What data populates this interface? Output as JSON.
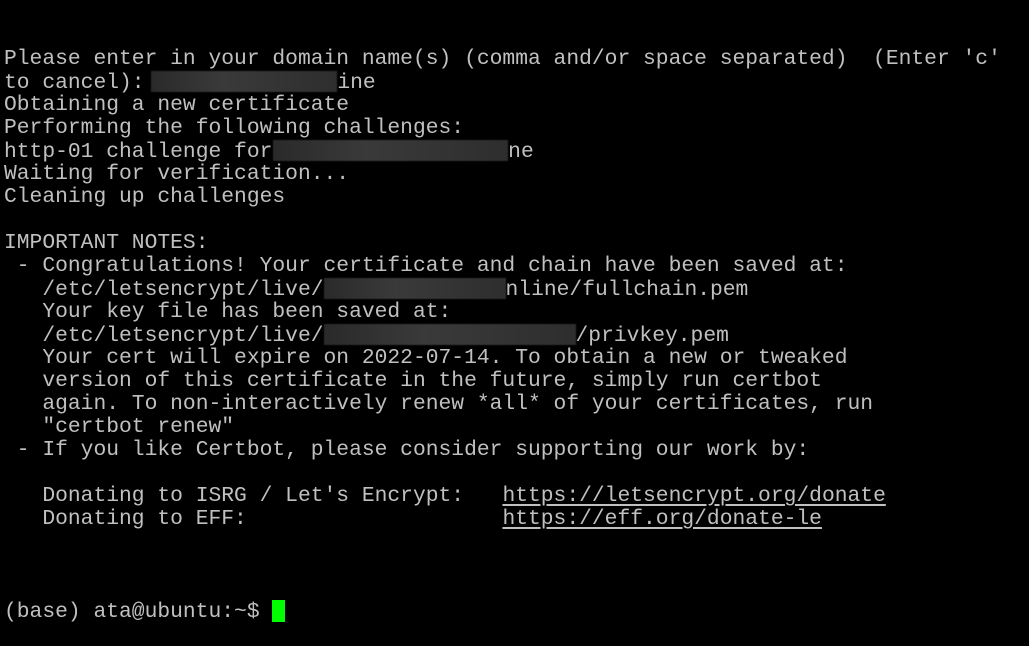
{
  "terminal": {
    "lines": [
      [
        {
          "t": "Please enter in your domain name(s) (comma and/or space separated)  (Enter 'c'"
        }
      ],
      [
        {
          "t": "to cancel): "
        },
        {
          "r": "r1"
        },
        {
          "t": "ine"
        }
      ],
      [
        {
          "t": "Obtaining a new certificate"
        }
      ],
      [
        {
          "t": "Performing the following challenges:"
        }
      ],
      [
        {
          "t": "http-01 challenge for "
        },
        {
          "r": "r2"
        },
        {
          "t": "ne"
        }
      ],
      [
        {
          "t": "Waiting for verification..."
        }
      ],
      [
        {
          "t": "Cleaning up challenges"
        }
      ],
      [
        {
          "t": ""
        }
      ],
      [
        {
          "t": "IMPORTANT NOTES:"
        }
      ],
      [
        {
          "t": " - Congratulations! Your certificate and chain have been saved at:"
        }
      ],
      [
        {
          "t": "   /etc/letsencrypt/live/"
        },
        {
          "r": "r3"
        },
        {
          "t": "nline/fullchain.pem"
        }
      ],
      [
        {
          "t": "   Your key file has been saved at:"
        }
      ],
      [
        {
          "t": "   /etc/letsencrypt/live/"
        },
        {
          "r": "r4"
        },
        {
          "t": "/privkey.pem"
        }
      ],
      [
        {
          "t": "   Your cert will expire on 2022-07-14. To obtain a new or tweaked"
        }
      ],
      [
        {
          "t": "   version of this certificate in the future, simply run certbot"
        }
      ],
      [
        {
          "t": "   again. To non-interactively renew *all* of your certificates, run"
        }
      ],
      [
        {
          "t": "   \"certbot renew\""
        }
      ],
      [
        {
          "t": " - If you like Certbot, please consider supporting our work by:"
        }
      ],
      [
        {
          "t": ""
        }
      ],
      [
        {
          "t": "   Donating to ISRG / Let's Encrypt:   "
        },
        {
          "link": "https://letsencrypt.org/donate"
        }
      ],
      [
        {
          "t": "   Donating to EFF:                    "
        },
        {
          "link": "https://eff.org/donate-le"
        }
      ],
      [
        {
          "t": ""
        }
      ]
    ],
    "prompt": "(base) ata@ubuntu:~$ ",
    "colors": {
      "background": "#000000",
      "text": "#c0c0c0",
      "cursor": "#00ff00"
    }
  }
}
